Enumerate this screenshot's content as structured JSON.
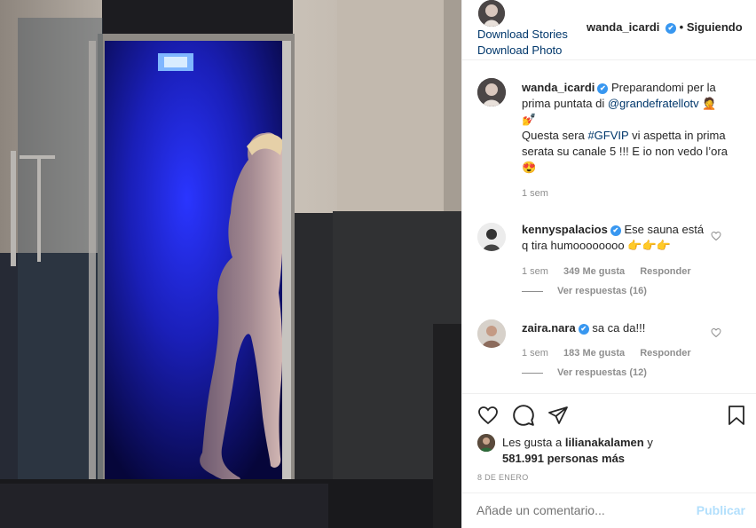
{
  "header": {
    "username": "wanda_icardi",
    "verified": "✔",
    "dot": "•",
    "follow_status": "Siguiendo",
    "download_stories": "Download Stories",
    "download_photo": "Download Photo"
  },
  "caption": {
    "username": "wanda_icardi",
    "verified": "✔",
    "line1": "Preparandomi per la prima puntata di",
    "mention": "@grandefratellotv",
    "emoji1": "🤦",
    "emoji2": "💅",
    "line2a": "Questa sera",
    "hashtag": "#GFVIP",
    "line2b": "vi aspetta in prima serata su canale 5 !!! E io non vedo l’ora",
    "emoji3": "😍",
    "time": "1 sem"
  },
  "comments": [
    {
      "username": "kennyspalacios",
      "verified": "✔",
      "text": "Ese sauna está q tira humoooooooo",
      "emoji": "👉👉👉",
      "time": "1 sem",
      "likes": "349 Me gusta",
      "reply": "Responder",
      "view_replies": "Ver respuestas (16)"
    },
    {
      "username": "zaira.nara",
      "verified": "✔",
      "text": "sa ca da!!!",
      "emoji": "",
      "time": "1 sem",
      "likes": "183 Me gusta",
      "reply": "Responder",
      "view_replies": "Ver respuestas (12)"
    }
  ],
  "likes": {
    "prefix": "Les gusta a",
    "user": "lilianakalamen",
    "mid": "y",
    "count": "581.991 personas más"
  },
  "date": "8 DE ENERO",
  "add_comment": {
    "placeholder": "Añade un comentario...",
    "publish": "Publicar"
  },
  "colors": {
    "link": "#00376b",
    "verified": "#3897f0",
    "publish_disabled": "#b2dffc",
    "meta": "#8e8e8e",
    "shower_blue": "#1a1fb8"
  },
  "icons": [
    "heart-icon",
    "comment-icon",
    "share-icon",
    "bookmark-icon",
    "verified-icon"
  ]
}
